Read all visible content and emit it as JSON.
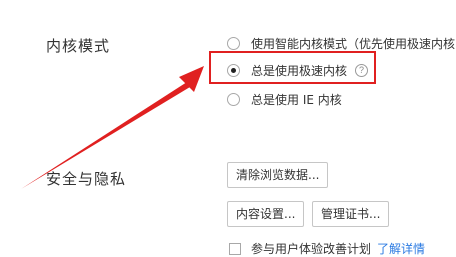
{
  "kernel_section": {
    "title": "内核模式",
    "options": [
      {
        "label": "使用智能内核模式（优先使用极速内核",
        "checked": false
      },
      {
        "label": "总是使用极速内核",
        "checked": true
      },
      {
        "label": "总是使用 IE 内核",
        "checked": false
      }
    ],
    "help_icon_glyph": "?"
  },
  "privacy_section": {
    "title": "安全与隐私",
    "buttons": {
      "clear_data": "清除浏览数据...",
      "content_settings": "内容设置...",
      "manage_certs": "管理证书..."
    },
    "checkbox_label": "参与用户体验改善计划",
    "checkbox_link": "了解详情"
  },
  "colors": {
    "highlight": "#e02020",
    "arrow": "#e02020"
  }
}
